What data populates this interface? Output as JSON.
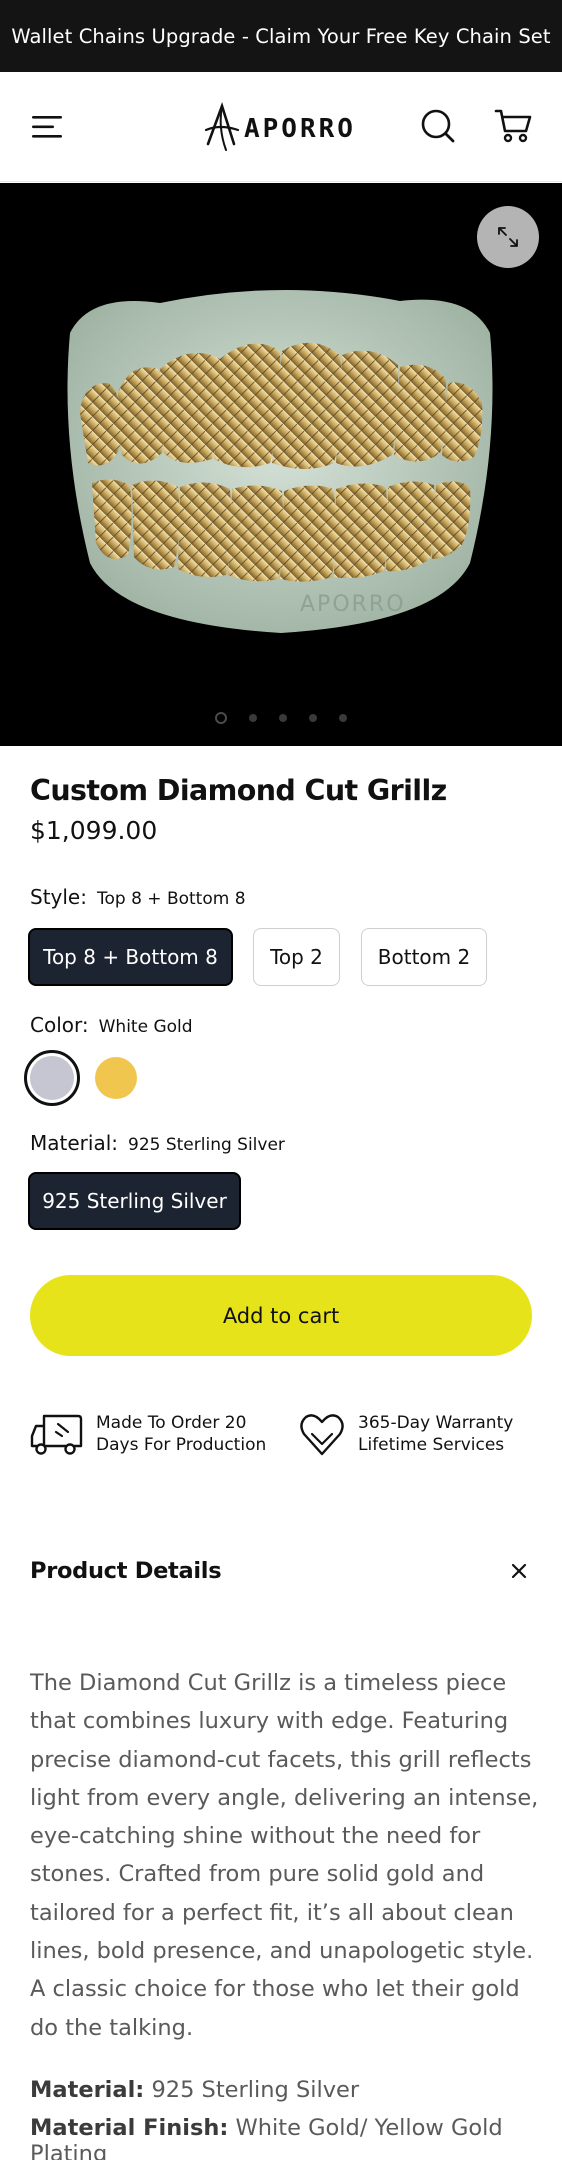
{
  "announcement": "Wallet Chains Upgrade - Claim Your Free Key Chain Set",
  "header": {
    "brand": "APORRO",
    "icons": [
      "menu-icon",
      "search-icon",
      "cart-icon"
    ]
  },
  "gallery": {
    "image_alt": "Custom Diamond Cut Grillz",
    "watermark": "APORRO",
    "zoom_icon": "expand-icon",
    "slide_count": 5,
    "active_slide": 1
  },
  "product": {
    "title": "Custom Diamond Cut Grillz",
    "price": "$1,099.00"
  },
  "options": {
    "style": {
      "label": "Style:",
      "selected": "Top 8 + Bottom 8",
      "values": [
        "Top 8 + Bottom 8",
        "Top 2",
        "Bottom 2"
      ]
    },
    "color": {
      "label": "Color:",
      "selected": "White Gold",
      "swatches": [
        {
          "name": "White Gold",
          "color": "#c5c6d1"
        },
        {
          "name": "Yellow Gold",
          "color": "#f0c64e"
        }
      ]
    },
    "material": {
      "label": "Material:",
      "selected": "925 Sterling Silver",
      "values": [
        "925 Sterling Silver"
      ]
    }
  },
  "cart": {
    "add_label": "Add to cart",
    "button_color": "#e6e31a"
  },
  "features": {
    "production": {
      "line1": "Made To Order 20",
      "line2": "Days For Production",
      "icon": "delivery-truck-icon"
    },
    "warranty": {
      "line1": "365-Day Warranty",
      "line2": "Lifetime Services",
      "icon": "heart-hands-icon"
    }
  },
  "details": {
    "title": "Product Details",
    "close_icon": "close-icon",
    "description": "The Diamond Cut Grillz is a timeless piece that combines luxury with edge. Featuring precise diamond-cut facets, this grill reflects light from every angle, delivering an intense, eye-catching shine without the need for stones. Crafted from pure solid gold and tailored for a perfect fit, it’s all about clean lines, bold presence, and unapologetic style. A classic choice for those who let their gold do the talking.",
    "specs": [
      {
        "label": "Material:",
        "value": "925 Sterling Silver"
      },
      {
        "label": "Material Finish:",
        "value": "White Gold/ Yellow Gold Plating"
      }
    ]
  }
}
